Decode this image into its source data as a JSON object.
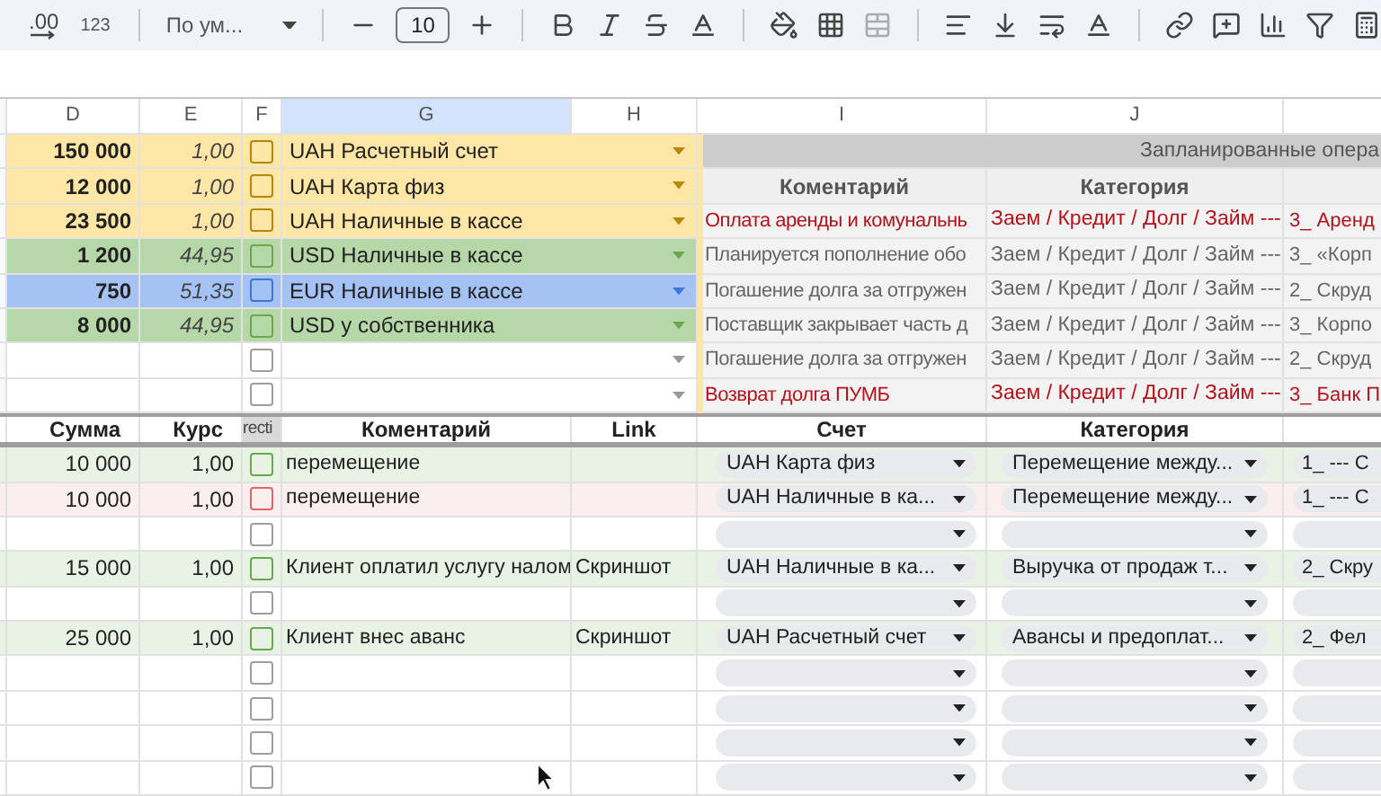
{
  "toolbar": {
    "decimal_label": ".00",
    "format_label": "123",
    "font": "По ум...",
    "font_size": "10"
  },
  "column_headers": [
    {
      "label": "D",
      "selected": false
    },
    {
      "label": "E",
      "selected": false
    },
    {
      "label": "F",
      "selected": false
    },
    {
      "label": "G",
      "selected": true
    },
    {
      "label": "H",
      "selected": false
    },
    {
      "label": "I",
      "selected": false
    },
    {
      "label": "J",
      "selected": false
    }
  ],
  "accounts": [
    {
      "kind": "account",
      "amount": "150 000",
      "rate": "1,00",
      "checked": false,
      "name": "UAH Расчетный счет",
      "color": "#fde6a6"
    },
    {
      "kind": "account",
      "amount": "12 000",
      "rate": "1,00",
      "checked": false,
      "name": "UAH Карта физ",
      "color": "#fde6a6"
    },
    {
      "kind": "account",
      "amount": "23 500",
      "rate": "1,00",
      "checked": false,
      "name": "UAH Наличные в кассе",
      "color": "#fde6a6"
    },
    {
      "kind": "account",
      "amount": "1 200",
      "rate": "44,95",
      "checked": false,
      "name": "USD Наличные в кассе",
      "color": "#b6d7a8"
    },
    {
      "kind": "account",
      "amount": "750",
      "rate": "51,35",
      "checked": false,
      "name": "EUR Наличные в кассе",
      "color": "#a4c2f4"
    },
    {
      "kind": "account",
      "amount": "8 000",
      "rate": "44,95",
      "checked": false,
      "name": "USD у собственника",
      "color": "#b6d7a8"
    },
    {
      "kind": "blank",
      "checked": false
    },
    {
      "kind": "blank",
      "checked": false
    }
  ],
  "planned": {
    "title": "Запланированные опера",
    "headers": [
      "Коментарий",
      "Категория"
    ],
    "rows": [
      {
        "comment": "Оплата аренды и комунальнь",
        "category": "Заем / Кредит / Долг / Займ ---",
        "column_3": "3_ Аренд",
        "color": "#b7121a"
      },
      {
        "comment": "Планируется пополнение обо",
        "category": "Заем / Кредит / Долг / Займ ---",
        "column_3": "3_ «Корп",
        "color": "#666666"
      },
      {
        "comment": "Погашение долга за отгружен",
        "category": "Заем / Кредит / Долг / Займ ---",
        "column_3": "2_ Скруд",
        "color": "#666666"
      },
      {
        "comment": "Поставщик закрывает часть д",
        "category": "Заем / Кредит / Долг / Займ ---",
        "column_3": "3_ Корпо",
        "color": "#666666"
      },
      {
        "comment": "Погашение долга за отгружен",
        "category": "Заем / Кредит / Долг / Займ ---",
        "column_3": "2_ Скруд",
        "color": "#666666"
      },
      {
        "comment": "Возврат долга ПУМБ",
        "category": "Заем / Кредит / Долг / Займ ---",
        "column_3": "3_ Банк П",
        "color": "#b7121a"
      }
    ]
  },
  "ledger": {
    "headers": [
      "Сумма",
      "Курс",
      "recti",
      "Коментарий",
      "Link",
      "Счет",
      "Категория"
    ],
    "rows": [
      {
        "kind": "entry",
        "color": "#e8f3e5",
        "amount": "10 000",
        "rate": "1,00",
        "checked": false,
        "comment": "перемещение",
        "account": "UAH Карта физ",
        "category": "Перемещение между...",
        "column_3": "1_ --- C"
      },
      {
        "kind": "entry",
        "color": "#fbeeee",
        "amount": "10 000",
        "rate": "1,00",
        "checked": false,
        "comment": "перемещение",
        "account": "UAH Наличные в ка...",
        "category": "Перемещение между...",
        "column_3": "1_ --- C"
      },
      {
        "kind": "blank",
        "checked": false
      },
      {
        "kind": "entry",
        "color": "#e8f3e5",
        "amount": "15 000",
        "rate": "1,00",
        "checked": false,
        "comment": "Клиент оплатил услугу налом",
        "link": "Скриншот",
        "account": "UAH Наличные в ка...",
        "category": "Выручка от продаж т...",
        "column_3": "2_ Скру"
      },
      {
        "kind": "blank",
        "checked": false
      },
      {
        "kind": "entry",
        "color": "#e8f3e5",
        "amount": "25 000",
        "rate": "1,00",
        "checked": false,
        "comment": "Клиент внес аванс",
        "link": "Скриншот",
        "account": "UAH Расчетный счет",
        "category": "Авансы и предоплат...",
        "column_3": "2_ Фел"
      },
      {
        "kind": "blank",
        "checked": false
      },
      {
        "kind": "blank",
        "checked": false
      },
      {
        "kind": "blank",
        "checked": false
      },
      {
        "kind": "blank",
        "checked": false
      }
    ]
  }
}
